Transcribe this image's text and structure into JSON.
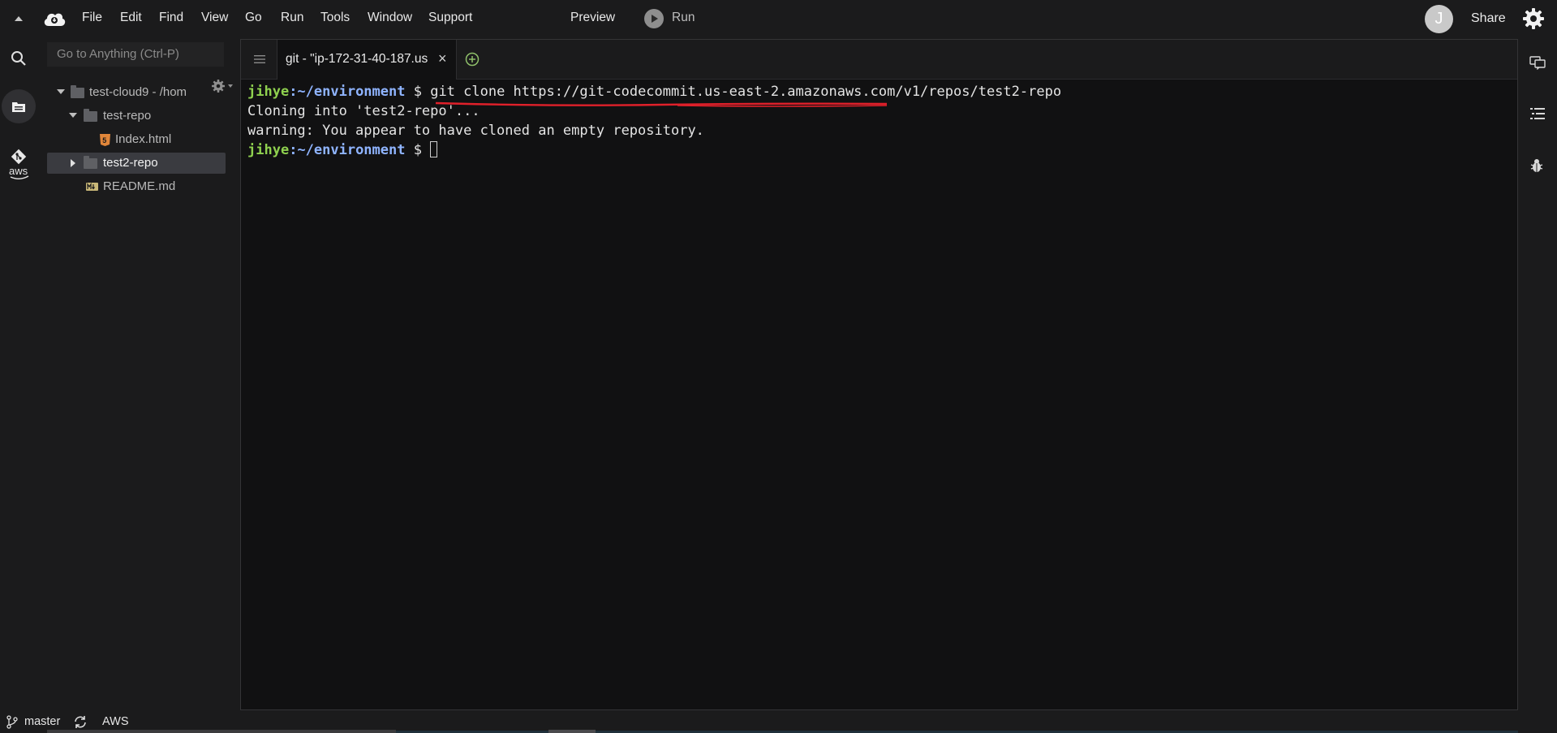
{
  "menubar": {
    "items": [
      "File",
      "Edit",
      "Find",
      "View",
      "Go",
      "Run",
      "Tools",
      "Window",
      "Support"
    ],
    "preview_label": "Preview",
    "run_label": "Run",
    "avatar_initial": "J",
    "share_label": "Share"
  },
  "sidebar": {
    "search_placeholder": "Go to Anything (Ctrl-P)",
    "aws_label": "aws",
    "tree": [
      {
        "label": "test-cloud9 - /hom",
        "type": "folder",
        "expanded": true
      },
      {
        "label": "test-repo",
        "type": "folder",
        "expanded": true
      },
      {
        "label": "Index.html",
        "type": "html-file"
      },
      {
        "label": "test2-repo",
        "type": "folder",
        "expanded": false,
        "selected": true
      },
      {
        "label": "README.md",
        "type": "md-file"
      }
    ]
  },
  "editor": {
    "tab_label": "git - \"ip-172-31-40-187.us",
    "tab_close": "×",
    "terminal": {
      "user": "jihye",
      "path": ":~/environment",
      "prompt_symbol": " $ ",
      "command": "git clone https://git-codecommit.us-east-2.amazonaws.com/v1/repos/test2-repo",
      "output_line1": "Cloning into 'test2-repo'...",
      "output_line2": "warning: You appear to have cloned an empty repository.",
      "user2": "jihye",
      "path2": ":~/environment",
      "prompt_symbol2": " $ "
    }
  },
  "statusbar": {
    "branch": "master",
    "aws_label": "AWS"
  },
  "colors": {
    "prompt_user": "#8fd14f",
    "prompt_path": "#8fb4ff",
    "annotation_underline": "#e0202a"
  }
}
